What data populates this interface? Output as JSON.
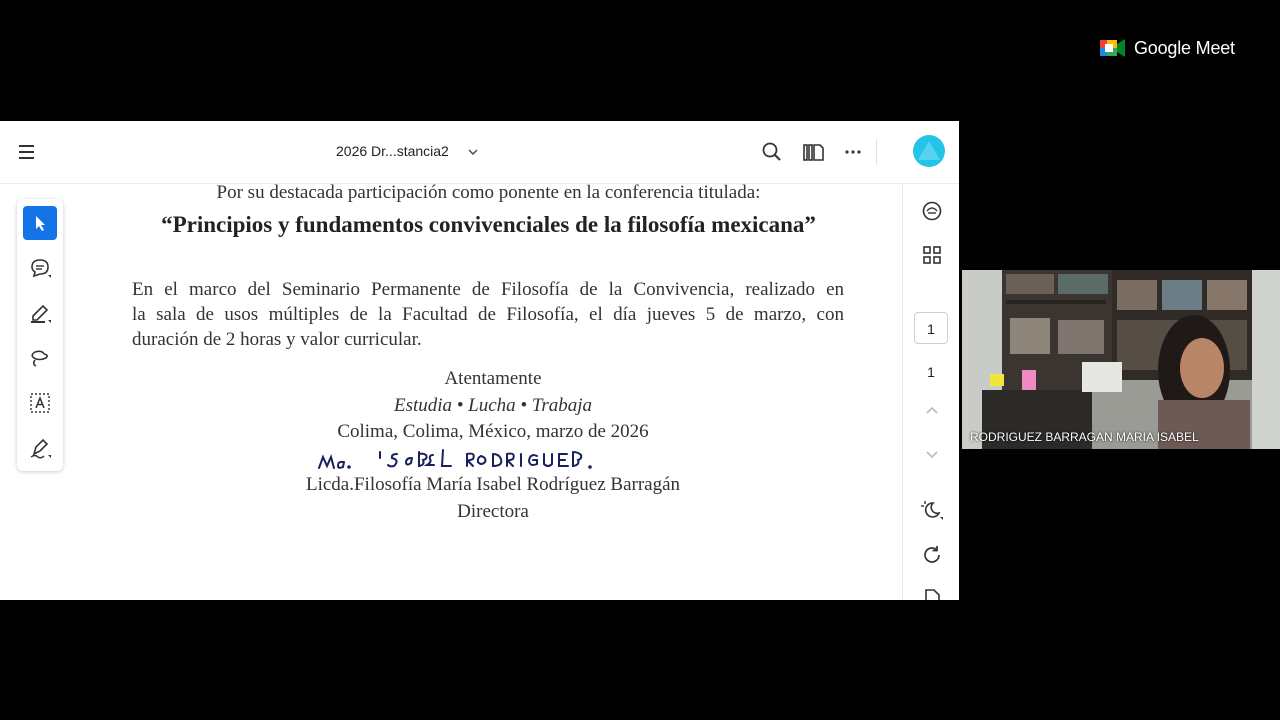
{
  "meet": {
    "brand": "Google Meet"
  },
  "viewer": {
    "doc_title": "2026 Dr...stancia2",
    "page_current": "1",
    "page_total": "1"
  },
  "document": {
    "intro": "Por su destacada participación como ponente en la conferencia titulada:",
    "conference_title": "“Principios y fundamentos convivenciales de la filosofía mexicana”",
    "body_lines": [
      "En el marco del Seminario Permanente de Filosofía de la Convivencia, realizado en",
      "la sala de usos múltiples de la Facultad de Filosofía, el día jueves 5 de marzo, con",
      "duración de 2 horas y valor curricular."
    ],
    "closing": "Atentamente",
    "motto": "Estudia • Lucha • Trabaja",
    "place_date": "Colima, Colima, México, marzo  de 2026",
    "handwritten_signature": "Ma. ISaBeL RODRIGUEZ B.",
    "signer": "Licda.Filosofía María Isabel Rodríguez Barragán",
    "signer_title": "Directora"
  },
  "participant": {
    "name": "RODRIGUEZ BARRAGAN MARIA ISABEL"
  },
  "icons": {
    "toolbar": [
      "menu-icon",
      "chevron-down-icon",
      "search-icon",
      "pages-icon",
      "more-icon",
      "avatar"
    ],
    "tools": [
      "select-icon",
      "comment-icon",
      "highlight-icon",
      "draw-icon",
      "text-recognition-icon",
      "sign-icon"
    ],
    "rail": [
      "comments-icon",
      "grid-icon",
      "scroll-up-icon",
      "scroll-down-icon",
      "dark-mode-icon",
      "refresh-icon",
      "file-icon"
    ]
  },
  "colors": {
    "accent": "#1473e6",
    "avatar": "#24c4e8",
    "background": "#000000"
  }
}
